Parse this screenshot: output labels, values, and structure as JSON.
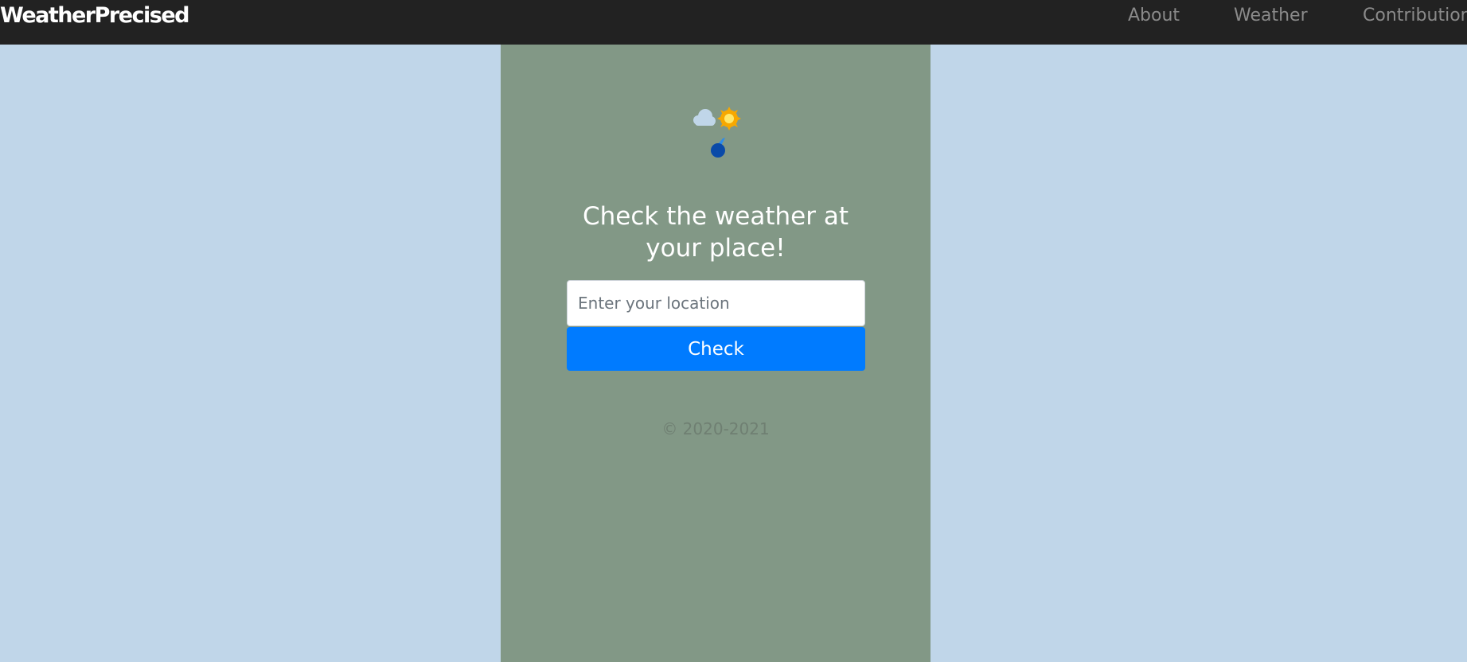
{
  "brand": {
    "name": "WeatherPrecised"
  },
  "nav": {
    "about": "About",
    "weather": "Weather",
    "contributions": "Contributions"
  },
  "main": {
    "logo_icon": "weather-logo-icon",
    "headline": "Check the weather at your place!",
    "location_placeholder": "Enter your location",
    "location_value": "",
    "check_label": "Check",
    "footer": "© 2020-2021"
  },
  "colors": {
    "page_background": "#c0d6e9",
    "navbar_background": "#222222",
    "panel_background": "#829886",
    "button_background": "#007bff"
  }
}
